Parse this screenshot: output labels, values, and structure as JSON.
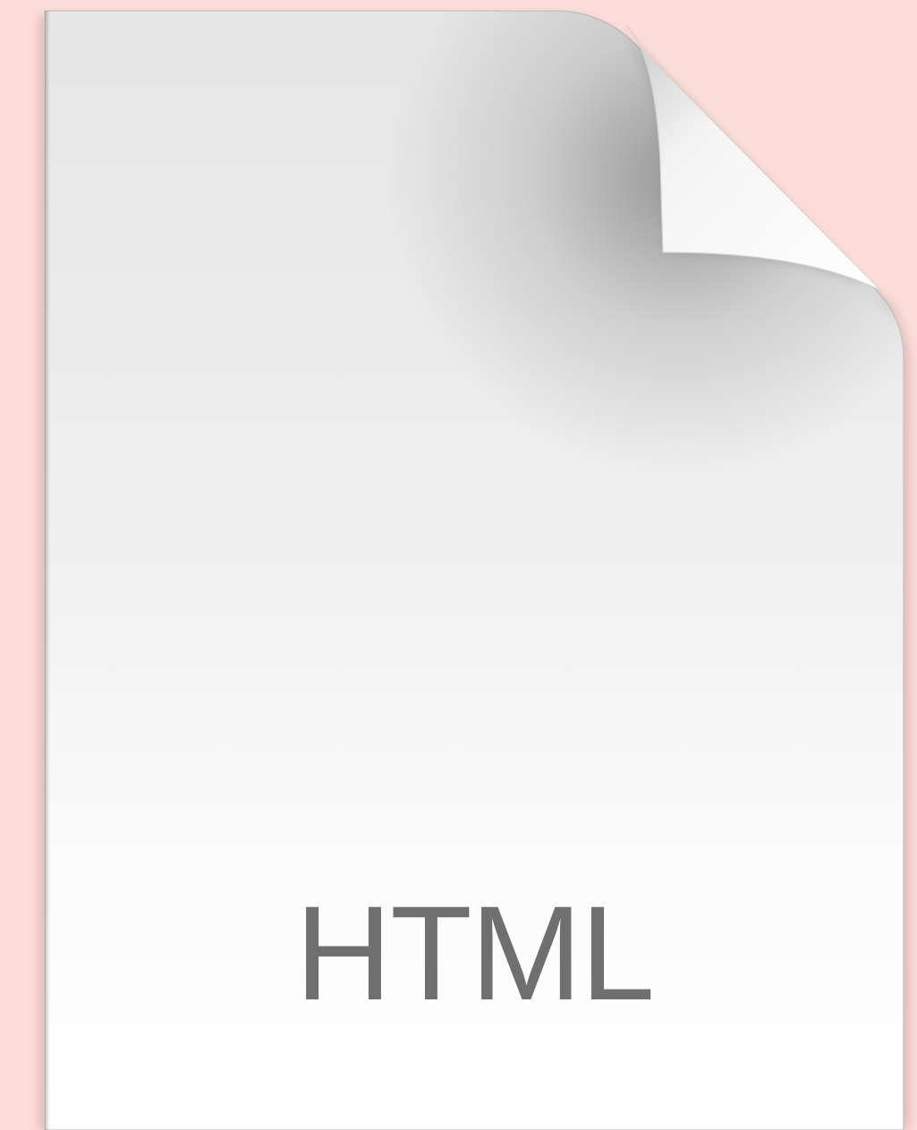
{
  "document_icon": {
    "icon_name": "html-file-icon",
    "file_type_label": "HTML"
  },
  "colors": {
    "background": "#fdddda",
    "page_top": "#e6e6e6",
    "page_bottom": "#ffffff",
    "label_text": "#6f6f6f"
  }
}
